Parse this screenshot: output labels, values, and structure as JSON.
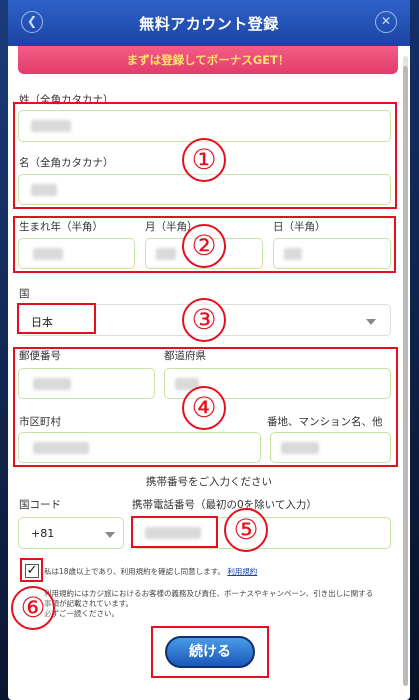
{
  "header": {
    "title": "無料アカウント登録",
    "back_icon": "chevron-left-icon",
    "close_icon": "close-icon"
  },
  "banner": {
    "text": "まずは登録してボーナスGET！"
  },
  "name": {
    "last_label": "姓（全角カタカナ）",
    "first_label": "名（全角カタカナ）"
  },
  "birth": {
    "year_label": "生まれ年（半角）",
    "month_label": "月（半角）",
    "day_label": "日（半角）"
  },
  "country": {
    "label": "国",
    "value": "日本"
  },
  "address": {
    "postal_label": "郵便番号",
    "prefecture_label": "都道府県",
    "city_label": "市区町村",
    "street_label": "番地、マンション名、他"
  },
  "phone": {
    "section_heading": "携帯番号をご入力ください",
    "country_code_label": "国コード",
    "country_code_value": "+81",
    "number_label": "携帯電話番号（最初の0を除いて入力）"
  },
  "terms": {
    "checkbox_mark": "✓",
    "agree_text": "私は18歳以上であり、利用規約を確認し同意します。",
    "link_text": "利用規約",
    "note_line1": "利用規約にはカジ旅におけるお客様の義務及び責任、ボーナスやキャンペーン、引き出しに関する",
    "note_line2": "事項が記載されています。",
    "note_line3": "必ずご一読ください。"
  },
  "cta": {
    "label": "続ける"
  },
  "annotations": [
    "①",
    "②",
    "③",
    "④",
    "⑤",
    "⑥"
  ],
  "colors": {
    "header": "#1b44a3",
    "banner": "#e23b6a",
    "annotation": "#e5101f"
  }
}
